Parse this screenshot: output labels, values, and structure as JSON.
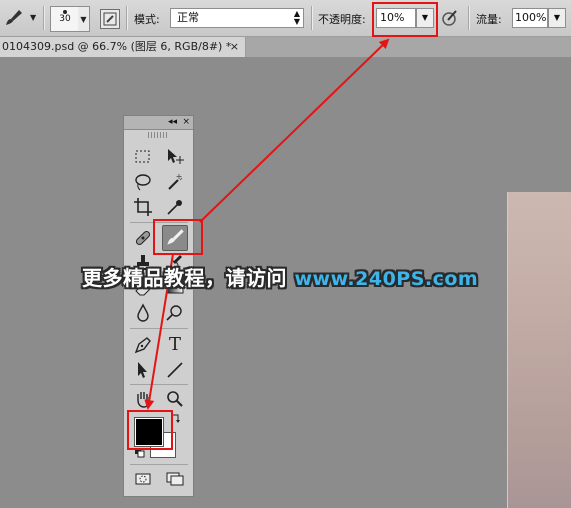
{
  "options_bar": {
    "brush_size": "30",
    "mode_label": "模式:",
    "mode_value": "正常",
    "opacity_label": "不透明度:",
    "opacity_value": "10%",
    "flow_label": "流量:",
    "flow_value": "100%"
  },
  "document_tab": {
    "title": "0104309.psd @ 66.7% (图层 6, RGB/8#) *",
    "close_glyph": "×"
  },
  "toolbox": {
    "collapse_glyph": "◂◂",
    "close_glyph": "×",
    "tools": [
      "marquee-tool",
      "move-tool",
      "lasso-tool",
      "magic-wand-tool",
      "crop-tool",
      "eyedropper-tool",
      "healing-brush-tool",
      "brush-tool",
      "clone-stamp-tool",
      "history-brush-tool",
      "eraser-tool",
      "gradient-tool",
      "blur-tool",
      "dodge-tool",
      "pen-tool",
      "type-tool",
      "path-selection-tool",
      "line-tool",
      "hand-tool",
      "zoom-tool"
    ],
    "active_tool": "brush-tool",
    "type_glyph": "T",
    "foreground_color": "#000000",
    "background_color": "#ffffff"
  },
  "watermark": {
    "chinese": "更多精品教程，请访问 ",
    "url": "www.240PS.com"
  },
  "annotation": {
    "color": "#e41414"
  }
}
